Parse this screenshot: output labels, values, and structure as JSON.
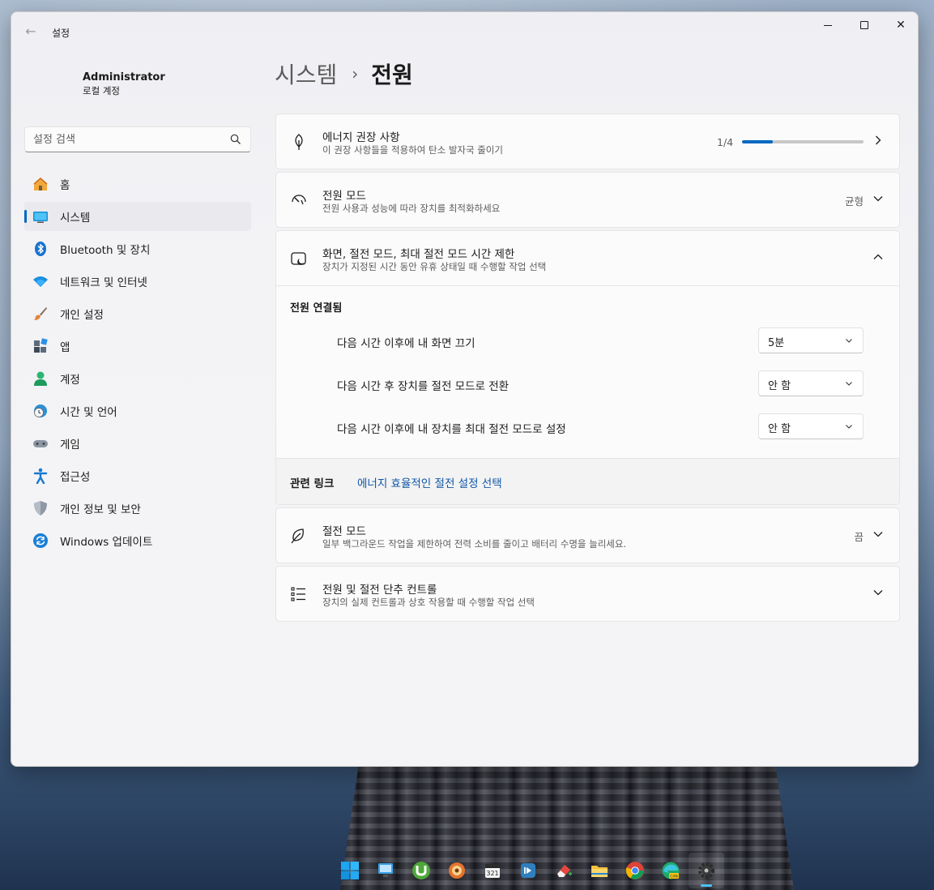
{
  "window": {
    "app_title": "설정",
    "back_glyph": "←",
    "close_glyph": "✕"
  },
  "user": {
    "name": "Administrator",
    "account_type": "로컬 계정"
  },
  "search": {
    "placeholder": "설정 검색"
  },
  "sidebar": {
    "items": [
      {
        "label": "홈",
        "icon": "home-icon",
        "active": false
      },
      {
        "label": "시스템",
        "icon": "system-icon",
        "active": true
      },
      {
        "label": "Bluetooth 및 장치",
        "icon": "bluetooth-icon",
        "active": false
      },
      {
        "label": "네트워크 및 인터넷",
        "icon": "wifi-icon",
        "active": false
      },
      {
        "label": "개인 설정",
        "icon": "brush-icon",
        "active": false
      },
      {
        "label": "앱",
        "icon": "apps-icon",
        "active": false
      },
      {
        "label": "계정",
        "icon": "account-icon",
        "active": false
      },
      {
        "label": "시간 및 언어",
        "icon": "clock-globe-icon",
        "active": false
      },
      {
        "label": "게임",
        "icon": "gamepad-icon",
        "active": false
      },
      {
        "label": "접근성",
        "icon": "accessibility-icon",
        "active": false
      },
      {
        "label": "개인 정보 및 보안",
        "icon": "shield-icon",
        "active": false
      },
      {
        "label": "Windows 업데이트",
        "icon": "update-icon",
        "active": false
      }
    ]
  },
  "breadcrumb": {
    "parent": "시스템",
    "separator": "›",
    "current": "전원"
  },
  "energy": {
    "title": "에너지 권장 사항",
    "subtitle": "이 권장 사항들을 적용하여 탄소 발자국 줄이기",
    "progress_label": "1/4",
    "progress_fraction": 0.25
  },
  "power_mode": {
    "title": "전원 모드",
    "subtitle": "전원 사용과 성능에 따라 장치를 최적화하세요",
    "value": "균형"
  },
  "screen_sleep": {
    "title": "화면, 절전 모드, 최대 절전 모드 시간 제한",
    "subtitle": "장치가 지정된 시간 동안 유휴 상태일 때 수행할 작업 선택",
    "section_header": "전원 연결됨",
    "settings": [
      {
        "label": "다음 시간 이후에 내 화면 끄기",
        "value": "5분"
      },
      {
        "label": "다음 시간 후 장치를 절전 모드로 전환",
        "value": "안 함"
      },
      {
        "label": "다음 시간 이후에 내 장치를 최대 절전 모드로 설정",
        "value": "안 함"
      }
    ],
    "related_label": "관련 링크",
    "related_link": "에너지 효율적인 절전 설정 선택"
  },
  "saver": {
    "title": "절전 모드",
    "subtitle": "일부 백그라운드 작업을 제한하여 전력 소비를 줄이고 배터리 수명을 늘리세요.",
    "value": "끔"
  },
  "lid_buttons": {
    "title": "전원 및 절전 단추 컨트롤",
    "subtitle": "장치의 실제 컨트롤과 상호 작용할 때 수행할 작업 선택"
  },
  "taskbar": {
    "icons": [
      "start-icon",
      "remote-desktop-icon",
      "utorrent-icon",
      "disk-tool-icon",
      "calendar-app-icon",
      "media-player-icon",
      "eraser-app-icon",
      "file-explorer-icon",
      "chrome-icon",
      "edge-canary-icon",
      "settings-icon"
    ]
  },
  "colors": {
    "accent": "#0067c0",
    "link": "#0f56a8"
  }
}
